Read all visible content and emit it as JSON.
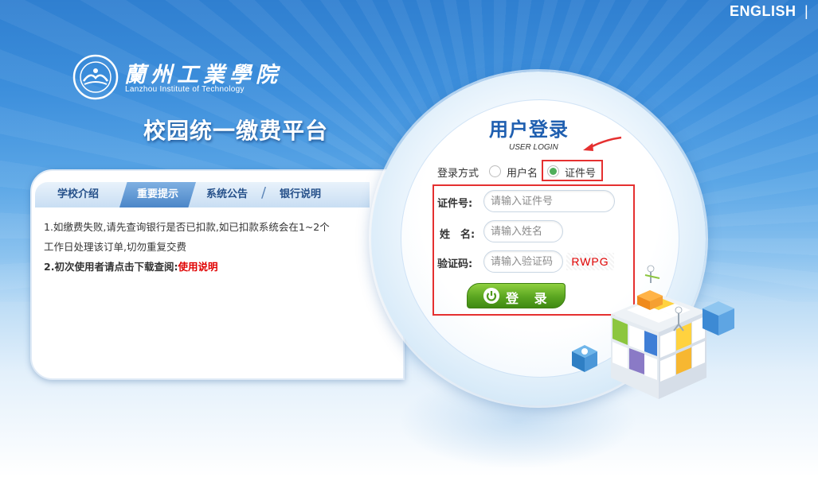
{
  "header": {
    "language_link": "ENGLISH",
    "separator": "|"
  },
  "logo": {
    "name_zh": "蘭州工業學院",
    "name_en": "Lanzhou Institute of Technology"
  },
  "platform_title": "校园统一缴费平台",
  "info": {
    "tabs": [
      {
        "label": "学校介绍",
        "active": false
      },
      {
        "label": "重要提示",
        "active": true
      },
      {
        "label": "系统公告",
        "active": false
      },
      {
        "label": "银行说明",
        "active": false
      }
    ],
    "notice_line1": "1.如缴费失败,请先查询银行是否已扣款,如已扣款系统会在1~2个",
    "notice_line2": "工作日处理该订单,切勿重复交费",
    "notice_line3_prefix": "2.初次使用者请点击下载查阅:",
    "notice_line3_link": "使用说明"
  },
  "login": {
    "title": "用户登录",
    "subtitle": "USER LOGIN",
    "mode_label": "登录方式",
    "mode_options": [
      {
        "label": "用户名",
        "checked": false
      },
      {
        "label": "证件号",
        "checked": true
      }
    ],
    "fields": {
      "id_label": "证件号:",
      "id_placeholder": "请输入证件号",
      "name_label": "姓　名:",
      "name_placeholder": "请输入姓名",
      "captcha_label": "验证码:",
      "captcha_placeholder": "请输入验证码",
      "captcha_code": "RWPG"
    },
    "submit_label": "登 录"
  },
  "colors": {
    "highlight": "#e53030",
    "accent_green": "#5aa521",
    "title_blue": "#1f5fb0"
  }
}
